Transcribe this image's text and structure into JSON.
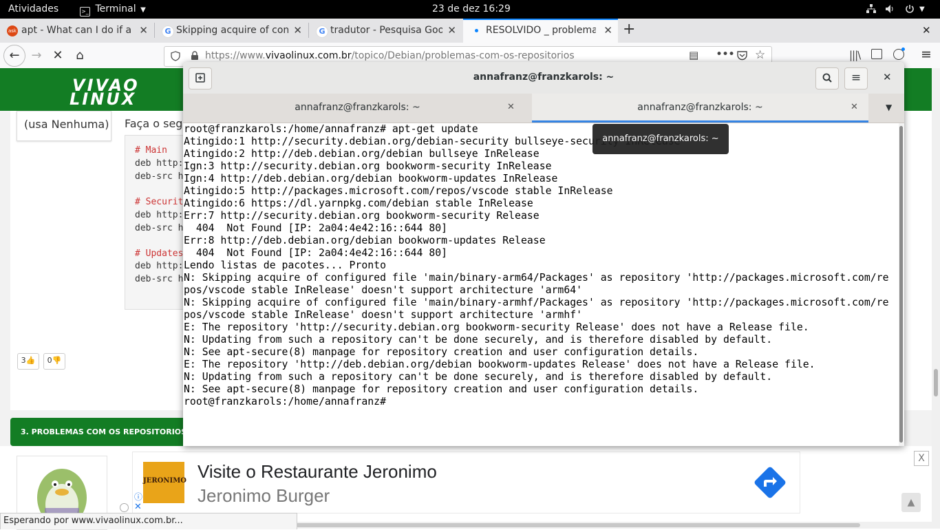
{
  "topbar": {
    "activities": "Atividades",
    "app_name": "Terminal",
    "clock": "23 de dez  16:29"
  },
  "browser": {
    "tabs": [
      {
        "title": "apt - What can I do if a re",
        "favicon": "askubuntu-icon",
        "color": "#dd4814"
      },
      {
        "title": "Skipping acquire of confi",
        "favicon": "google-icon",
        "color": "#4285f4"
      },
      {
        "title": "tradutor - Pesquisa Goog",
        "favicon": "google-icon",
        "color": "#4285f4"
      },
      {
        "title": "RESOLVIDO _ problema",
        "favicon": "loading-dot-icon",
        "color": "#0a84ff",
        "active": true
      }
    ],
    "url": {
      "prefix": "https://www.",
      "domain": "vivaolinux.com.br",
      "path": "/topico/Debian/problemas-com-os-repositorios"
    },
    "status": "Esperando por www.vivaolinux.com.br..."
  },
  "site": {
    "logo_line1": "VIVAO",
    "logo_line2": "LINUX",
    "usa_label": "(usa Nenhuma)",
    "faca_label": "Faça o segu",
    "code": [
      {
        "text": "# Main",
        "comment": true
      },
      {
        "text": "deb http:",
        "comment": false
      },
      {
        "text": "deb-src h",
        "comment": false
      },
      {
        "text": "# Securit",
        "comment": true
      },
      {
        "text": "deb http:",
        "comment": false
      },
      {
        "text": "deb-src h",
        "comment": false
      },
      {
        "text": "# Updates",
        "comment": true
      },
      {
        "text": "deb http:",
        "comment": false
      },
      {
        "text": "deb-src h",
        "comment": false
      }
    ],
    "votes_up": "3",
    "votes_down": "0",
    "section_title": "3. PROBLEMAS COM OS REPOSITORIOS",
    "ad": {
      "brand": "JERONIMO",
      "title": "Visite o Restaurante Jeronimo",
      "subtitle": "Jeronimo Burger",
      "close": "X"
    }
  },
  "terminal": {
    "window_title": "annafranz@franzkarols: ~",
    "tabs": [
      "annafranz@franzkarols: ~",
      "annafranz@franzkarols: ~"
    ],
    "tooltip": "annafranz@franzkarols: ~",
    "lines": [
      "root@franzkarols:/home/annafranz# apt-get update",
      "Atingido:1 http://security.debian.org/debian-security bullseye-security InRelease",
      "Atingido:2 http://deb.debian.org/debian bullseye InRelease",
      "Ign:3 http://security.debian.org bookworm-security InRelease",
      "Ign:4 http://deb.debian.org/debian bookworm-updates InRelease",
      "Atingido:5 http://packages.microsoft.com/repos/vscode stable InRelease",
      "Atingido:6 https://dl.yarnpkg.com/debian stable InRelease",
      "Err:7 http://security.debian.org bookworm-security Release",
      "  404  Not Found [IP: 2a04:4e42:16::644 80]",
      "Err:8 http://deb.debian.org/debian bookworm-updates Release",
      "  404  Not Found [IP: 2a04:4e42:16::644 80]",
      "Lendo listas de pacotes... Pronto",
      "N: Skipping acquire of configured file 'main/binary-arm64/Packages' as repository 'http://packages.microsoft.com/re",
      "pos/vscode stable InRelease' doesn't support architecture 'arm64'",
      "N: Skipping acquire of configured file 'main/binary-armhf/Packages' as repository 'http://packages.microsoft.com/re",
      "pos/vscode stable InRelease' doesn't support architecture 'armhf'",
      "E: The repository 'http://security.debian.org bookworm-security Release' does not have a Release file.",
      "N: Updating from such a repository can't be done securely, and is therefore disabled by default.",
      "N: See apt-secure(8) manpage for repository creation and user configuration details.",
      "E: The repository 'http://deb.debian.org/debian bookworm-updates Release' does not have a Release file.",
      "N: Updating from such a repository can't be done securely, and is therefore disabled by default.",
      "N: See apt-secure(8) manpage for repository creation and user configuration details.",
      "root@franzkarols:/home/annafranz# "
    ]
  },
  "colors": {
    "brand_green": "#137d24",
    "firefox_blue": "#0a84ff",
    "topbar_bg": "#000000"
  }
}
